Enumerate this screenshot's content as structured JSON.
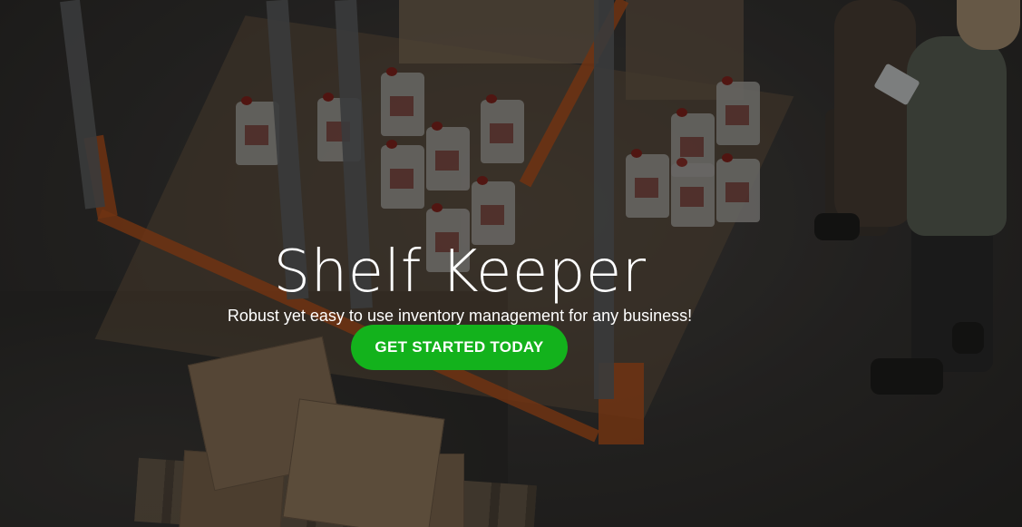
{
  "hero": {
    "title": "Shelf Keeper",
    "subtitle": "Robust yet easy to use inventory management for any business!",
    "cta_label": "GET STARTED TODAY"
  },
  "colors": {
    "cta_background": "#13b21c",
    "text": "#ffffff",
    "overlay": "rgba(0,0,0,0.38)"
  },
  "background_image": {
    "subject": "warehouse-shelving-with-boxes-and-workers"
  }
}
